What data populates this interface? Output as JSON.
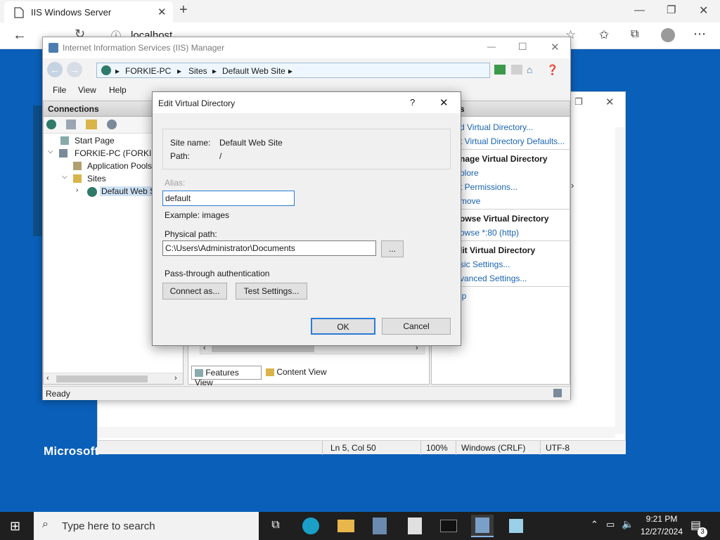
{
  "browser": {
    "tab_title": "IIS Windows Server",
    "address": "localhost"
  },
  "desktop": {
    "logo": "Microsoft"
  },
  "notepad": {
    "status": {
      "position": "Ln 5, Col 50",
      "zoom": "100%",
      "line_ending": "Windows (CRLF)",
      "encoding": "UTF-8"
    }
  },
  "iis": {
    "title": "Internet Information Services (IIS) Manager",
    "breadcrumb": [
      "FORKIE-PC",
      "Sites",
      "Default Web Site"
    ],
    "menu": [
      "File",
      "View",
      "Help"
    ],
    "connections_header": "Connections",
    "tree": {
      "start_page": "Start Page",
      "server": "FORKIE-PC (FORKIE-P",
      "app_pools": "Application Pools",
      "sites": "Sites",
      "default_site": "Default Web S"
    },
    "actions": {
      "header": "s",
      "add_vdir": "d Virtual Directory...",
      "vdir_defaults": "t Virtual Directory Defaults...",
      "manage_head": "nage Virtual Directory",
      "explore": "plore",
      "edit_perms": "t Permissions...",
      "remove": "move",
      "browse_head": "owse Virtual Directory",
      "browse_80": "owse *:80 (http)",
      "edit_head": "lit Virtual Directory",
      "basic": "sic Settings...",
      "advanced": "vanced Settings...",
      "help": "lp"
    },
    "views": {
      "features": "Features View",
      "content": "Content View"
    },
    "status": "Ready"
  },
  "dialog": {
    "title": "Edit Virtual Directory",
    "help_glyph": "?",
    "site_name_label": "Site name:",
    "site_name_value": "Default Web Site",
    "path_label": "Path:",
    "path_value": "/",
    "alias_label": "Alias:",
    "alias_value": "default",
    "example": "Example: images",
    "physical_path_label": "Physical path:",
    "physical_path_value": "C:\\Users\\Administrator\\Documents",
    "browse_label": "...",
    "pass_through_label": "Pass-through authentication",
    "connect_as": "Connect as...",
    "test_settings": "Test Settings...",
    "ok": "OK",
    "cancel": "Cancel"
  },
  "taskbar": {
    "search_placeholder": "Type here to search",
    "time": "9:21 PM",
    "date": "12/27/2024",
    "notification_count": "3"
  },
  "colors": {
    "desktop": "#0a5fb8",
    "link": "#1a64b4",
    "default_button_border": "#2b7bd6"
  }
}
